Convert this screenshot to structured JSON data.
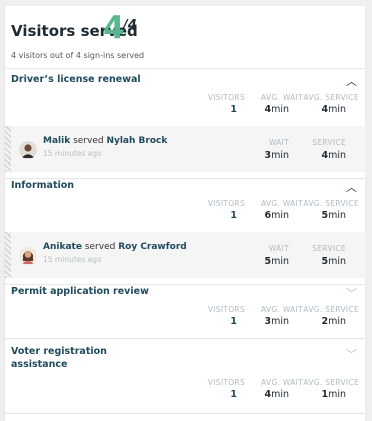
{
  "header": {
    "title": "Visitors served",
    "served": "4",
    "total": "/4",
    "subtitle": "4 visitors out of 4 sign-ins served"
  },
  "labels": {
    "visitors": "VISITORS",
    "avg_wait": "AVG. WAIT",
    "avg_service": "AVG. SERVICE",
    "wait": "WAIT",
    "service": "SERVICE",
    "min": "min",
    "served": "served"
  },
  "sections": [
    {
      "title": "Driver’s license renewal",
      "expanded": true,
      "visitors": "1",
      "avg_wait": "4",
      "avg_service": "4",
      "entry": {
        "staff": "Malik",
        "visitor": "Nylah Brock",
        "ago": "15 minutes ago",
        "wait": "3",
        "service": "4"
      }
    },
    {
      "title": "Information",
      "expanded": true,
      "visitors": "1",
      "avg_wait": "6",
      "avg_service": "5",
      "entry": {
        "staff": "Anikate",
        "visitor": "Roy Crawford",
        "ago": "15 minutes ago",
        "wait": "5",
        "service": "5"
      }
    },
    {
      "title": "Permit application review",
      "expanded": false,
      "visitors": "1",
      "avg_wait": "3",
      "avg_service": "2"
    },
    {
      "title_line1": "Voter registration",
      "title_line2": "assistance",
      "expanded": false,
      "visitors": "1",
      "avg_wait": "4",
      "avg_service": "1"
    }
  ],
  "colors": {
    "accent": "#59b68e",
    "section_title": "#1f4b5c",
    "muted": "#b0bcc3"
  }
}
